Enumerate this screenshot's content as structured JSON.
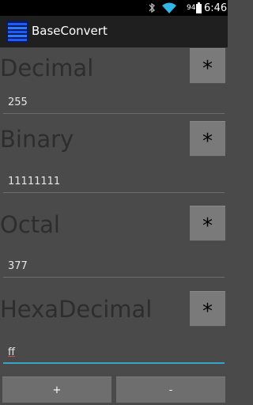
{
  "status_bar": {
    "battery": "94",
    "time": "6:46",
    "icons": [
      "bluetooth-icon",
      "wifi-icon",
      "battery-icon"
    ]
  },
  "app": {
    "title": "BaseConvert",
    "icon": "app-icon"
  },
  "sections": [
    {
      "label": "Decimal",
      "value": "255",
      "star": "*"
    },
    {
      "label": "Binary",
      "value": "11111111",
      "star": "*"
    },
    {
      "label": "Octal",
      "value": "377",
      "star": "*"
    },
    {
      "label": "HexaDecimal",
      "value": "ff",
      "star": "*"
    }
  ],
  "buttons": {
    "plus": "+",
    "minus": "-"
  },
  "colors": {
    "background": "#4a4a4a",
    "accent": "#35a6c9"
  }
}
